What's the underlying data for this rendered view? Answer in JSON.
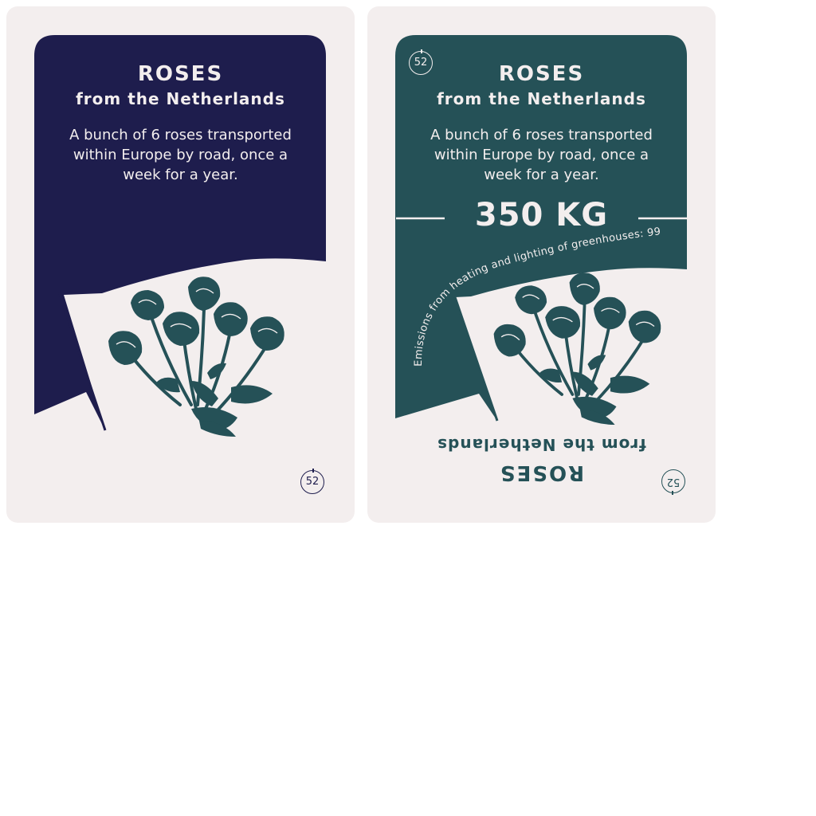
{
  "colors": {
    "card_background": "#f3eeee",
    "front_accent": "#1e1d4d",
    "back_accent": "#255157",
    "rose": "#255157",
    "text_light": "#f3eeee"
  },
  "front_card": {
    "title": "ROSES",
    "subtitle": "from the Netherlands",
    "description": "A bunch of 6 roses transported within Europe by road, once a week for a year.",
    "number": "52",
    "icon": "rose-bouquet-icon"
  },
  "back_card": {
    "number": "52",
    "title": "ROSES",
    "subtitle": "from the Netherlands",
    "description": "A bunch of 6 roses transported within Europe by road, once a week for a year.",
    "emissions_value": "350 KG",
    "emissions_note": "Emissions from heating and lighting of greenhouses: 99 %",
    "flipped_title": "ROSES",
    "flipped_subtitle": "from the Netherlands",
    "flipped_number": "52",
    "icon": "rose-bouquet-icon"
  }
}
